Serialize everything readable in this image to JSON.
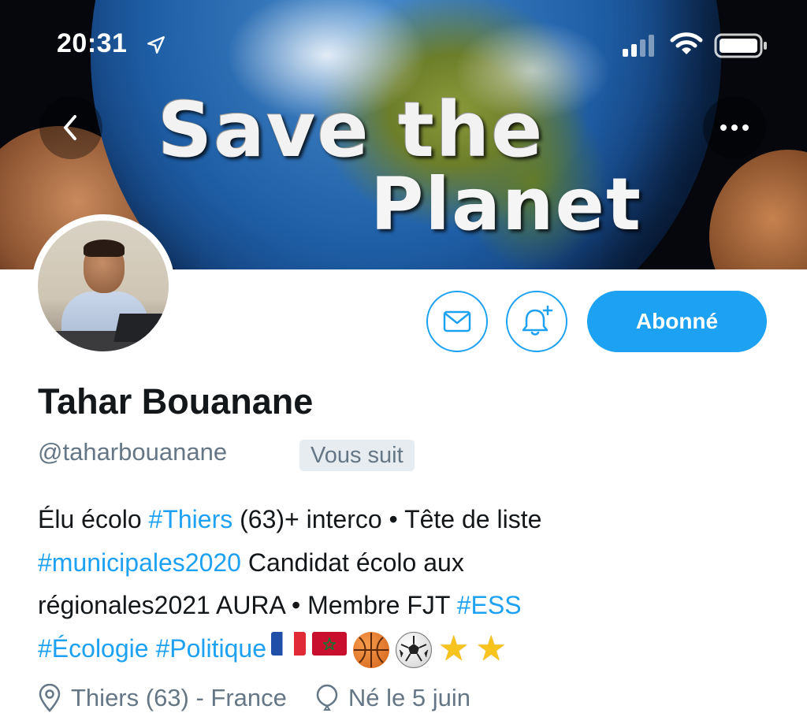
{
  "status_bar": {
    "time": "20:31"
  },
  "banner": {
    "line1": "Save the",
    "line2": "Planet"
  },
  "actions": {
    "follow_label": "Abonné"
  },
  "profile": {
    "name": "Tahar Bouanane",
    "handle": "@taharbouanane",
    "follows_you": "Vous suit",
    "bio": {
      "l1_a": "Élu écolo ",
      "l1_tag": "#Thiers",
      "l1_b": " (63)+ interco • Tête de liste",
      "l2_tag": "#municipales2020",
      "l2_b": " Candidat écolo aux",
      "l3_a": "régionales2021 AURA • Membre FJT ",
      "l3_tag": "#ESS",
      "l4_tag1": "#Écologie",
      "l4_sp": " ",
      "l4_tag2": "#Politique",
      "emojis": [
        "flag-france",
        "flag-morocco",
        "basketball",
        "soccer-ball",
        "star",
        "star"
      ]
    },
    "location": "Thiers (63) - France",
    "birthday": "Né le 5 juin"
  },
  "colors": {
    "accent": "#1da1f2",
    "secondary_text": "#657786",
    "badge_bg": "#e6ecf0"
  }
}
